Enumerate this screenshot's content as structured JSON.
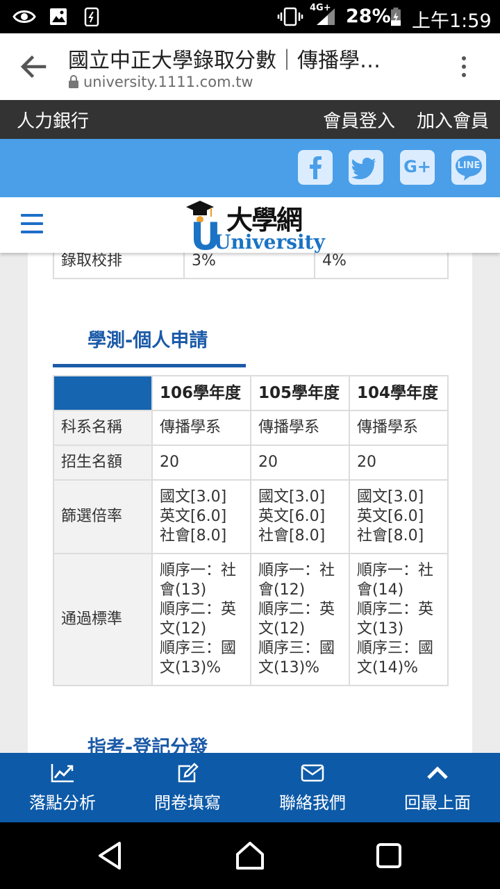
{
  "status_bar": {
    "network": "4G+",
    "battery": "28%",
    "time": "上午1:59"
  },
  "browser": {
    "title": "國立中正大學錄取分數｜傳播學…",
    "url": "university.1111.com.tw"
  },
  "site_bar": {
    "brand": "人力銀行",
    "login": "會員登入",
    "join": "加入會員"
  },
  "social": [
    "facebook-icon",
    "twitter-icon",
    "google-plus-icon",
    "line-icon"
  ],
  "social_labels": {
    "google_plus": "G+",
    "line": "LINE"
  },
  "logo": {
    "chinese": "大學網",
    "english": "University"
  },
  "prev_table": {
    "label": "錄取校排",
    "values": [
      "3%",
      "4%"
    ]
  },
  "section1": {
    "title": "學測-個人申請",
    "headers": [
      "106學年度",
      "105學年度",
      "104學年度"
    ],
    "rows": [
      {
        "label": "科系名稱",
        "cells": [
          "傳播學系",
          "傳播學系",
          "傳播學系"
        ]
      },
      {
        "label": "招生名額",
        "cells": [
          "20",
          "20",
          "20"
        ]
      },
      {
        "label": "篩選倍率",
        "cells": [
          [
            "國文[3.0]",
            "英文[6.0]",
            "社會[8.0]"
          ],
          [
            "國文[3.0]",
            "英文[6.0]",
            "社會[8.0]"
          ],
          [
            "國文[3.0]",
            "英文[6.0]",
            "社會[8.0]"
          ]
        ]
      },
      {
        "label": "通過標準",
        "cells": [
          [
            "順序一：社",
            "會(13)",
            "順序二：英",
            "文(12)",
            "順序三：國",
            "文(13)%"
          ],
          [
            "順序一：社",
            "會(12)",
            "順序二：英",
            "文(12)",
            "順序三：國",
            "文(13)%"
          ],
          [
            "順序一：社",
            "會(14)",
            "順序二：英",
            "文(13)",
            "順序三：國",
            "文(14)%"
          ]
        ]
      }
    ]
  },
  "section2": {
    "title": "指考-登記分發"
  },
  "bottom_nav": [
    {
      "icon": "line-chart-icon",
      "label": "落點分析"
    },
    {
      "icon": "edit-icon",
      "label": "問卷填寫"
    },
    {
      "icon": "mail-icon",
      "label": "聯絡我們"
    },
    {
      "icon": "chevron-up-icon",
      "label": "回最上面"
    }
  ],
  "colors": {
    "primary_blue": "#0d5aa8",
    "social_blue": "#4a9fe8",
    "section_title": "#1b5aa8",
    "dark_bar": "#333333",
    "corner_cell": "#1565b0"
  }
}
